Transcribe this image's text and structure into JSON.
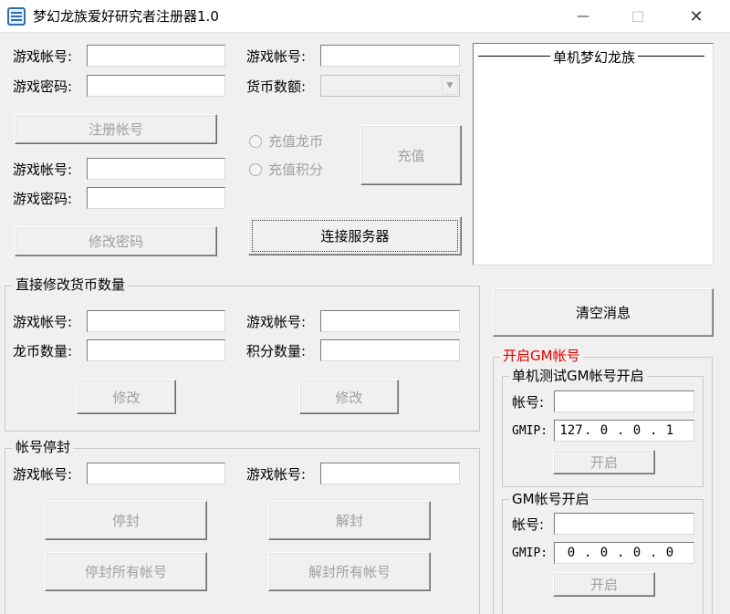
{
  "window": {
    "title": "梦幻龙族爱好研究者注册器1.0",
    "minimize_glyph": "—",
    "maximize_glyph": "☐",
    "close_glyph": "✕"
  },
  "register": {
    "account_label": "游戏帐号:",
    "password_label": "游戏密码:",
    "register_button": "注册帐号"
  },
  "change_password": {
    "account_label": "游戏帐号:",
    "password_label": "游戏密码:",
    "button": "修改密码"
  },
  "recharge": {
    "account_label": "游戏帐号:",
    "currency_label": "货币数额:",
    "option_dragon_coin": "充值龙币",
    "option_points": "充值积分",
    "button": "充值",
    "connect_button": "连接服务器"
  },
  "messages": {
    "header": "单机梦幻龙族",
    "clear_button": "清空消息"
  },
  "direct_modify": {
    "group_title": "直接修改货币数量",
    "account_label_left": "游戏帐号:",
    "dragon_coin_label": "龙币数量:",
    "modify_button_left": "修改",
    "account_label_right": "游戏帐号:",
    "points_label": "积分数量:",
    "modify_button_right": "修改"
  },
  "ban": {
    "group_title": "帐号停封",
    "account_label_left": "游戏帐号:",
    "ban_button": "停封",
    "ban_all_button": "停封所有帐号",
    "account_label_right": "游戏帐号:",
    "unban_button": "解封",
    "unban_all_button": "解封所有帐号"
  },
  "gm": {
    "group_title": "开启GM帐号",
    "local_group_title": "单机测试GM帐号开启",
    "local_account_label": "帐号:",
    "local_ip_label": "GMIP:",
    "local_ip": [
      "127",
      "0",
      "0",
      "1"
    ],
    "local_open_button": "开启",
    "remote_group_title": "GM帐号开启",
    "remote_account_label": "帐号:",
    "remote_ip_label": "GMIP:",
    "remote_ip": [
      "0",
      "0",
      "0",
      "0"
    ],
    "remote_open_button": "开启"
  },
  "colors": {
    "gm_title": "#e00000",
    "disabled_text": "#a0a0a0",
    "window_bg": "#f0f0f0"
  }
}
